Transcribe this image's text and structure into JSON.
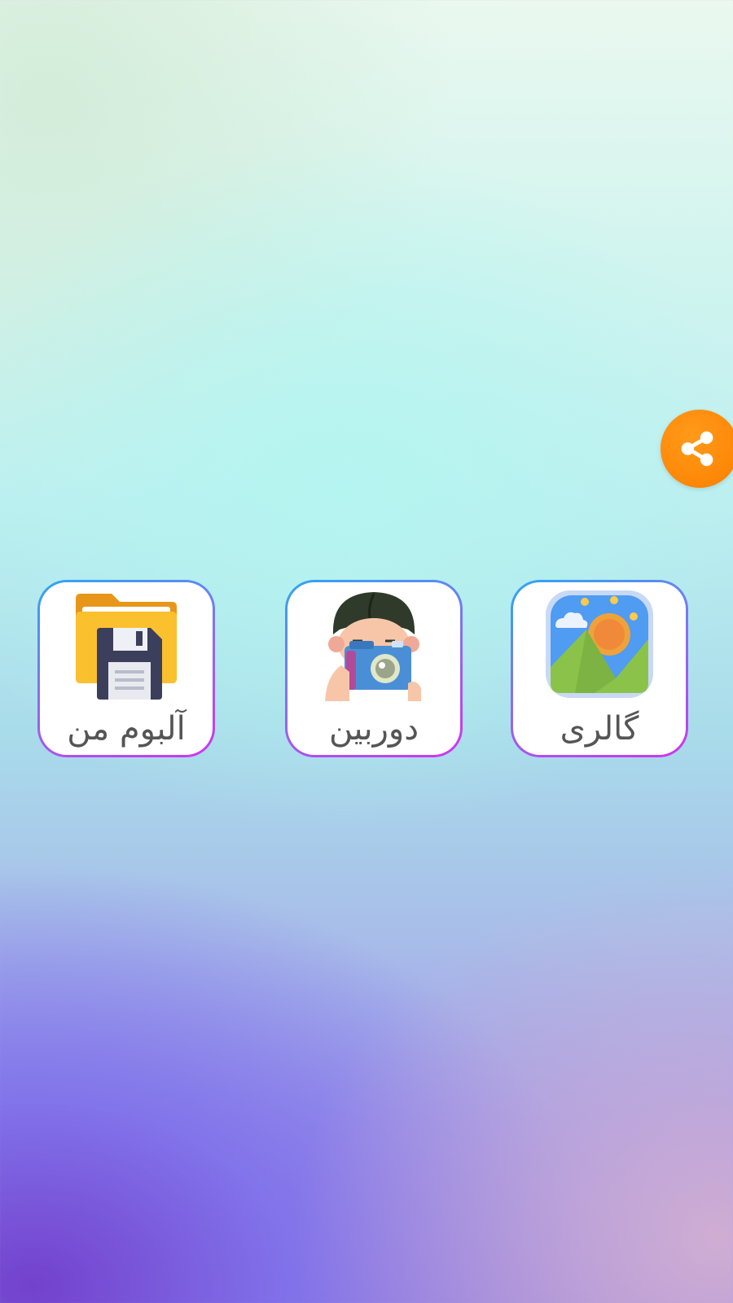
{
  "share": {
    "icon": "share-icon",
    "color": "#ff8a0a"
  },
  "tiles": [
    {
      "label": "آلبوم من",
      "icon": "folder-floppy-icon"
    },
    {
      "label": "دوربین",
      "icon": "photographer-camera-icon"
    },
    {
      "label": "گالری",
      "icon": "gallery-landscape-icon"
    }
  ],
  "colors": {
    "tile_border_start": "#2fa6f2",
    "tile_border_end": "#d233f0",
    "label_text": "#555555"
  }
}
